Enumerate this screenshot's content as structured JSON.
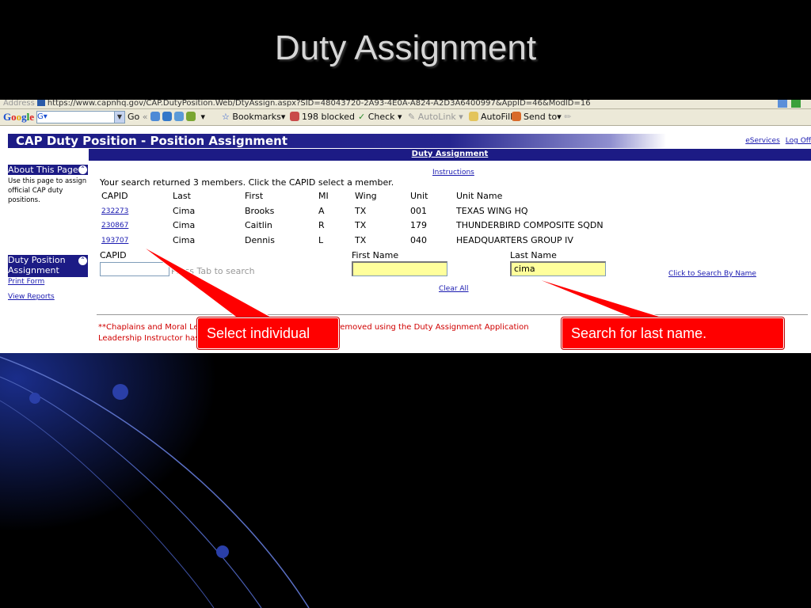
{
  "slide": {
    "title": "Duty Assignment"
  },
  "browser": {
    "address_label": "Address",
    "url": "https://www.capnhq.gov/CAP.DutyPosition.Web/DtyAssign.aspx?SID=48043720-2A93-4E0A-A824-A2D3A6400997&AppID=46&ModID=16",
    "google_logo": [
      "G",
      "o",
      "o",
      "g",
      "l",
      "e"
    ],
    "search_value": "G▾",
    "toolbar": {
      "go": "Go",
      "bookmarks": "Bookmarks▾",
      "blocked": "198 blocked",
      "check": "Check ▾",
      "autolink": "AutoLink ▾",
      "autofill": "AutoFill",
      "send_to": "Send to▾"
    }
  },
  "page": {
    "title": "CAP Duty Position - Position Assignment",
    "top_links": [
      "eServices",
      "Log Off"
    ],
    "section_title": "Duty Assignment",
    "instructions_link": "Instructions",
    "search_result": "Your search returned 3 members. Click the CAPID select a member.",
    "columns": [
      "CAPID",
      "Last",
      "First",
      "MI",
      "Wing",
      "Unit",
      "Unit Name"
    ],
    "rows": [
      {
        "capid": "232273",
        "last": "Cima",
        "first": "Brooks",
        "mi": "A",
        "wing": "TX",
        "unit": "001",
        "unit_name": "TEXAS WING HQ"
      },
      {
        "capid": "230867",
        "last": "Cima",
        "first": "Caitlin",
        "mi": "R",
        "wing": "TX",
        "unit": "179",
        "unit_name": "THUNDERBIRD COMPOSITE SQDN"
      },
      {
        "capid": "193707",
        "last": "Cima",
        "first": "Dennis",
        "mi": "L",
        "wing": "TX",
        "unit": "040",
        "unit_name": "HEADQUARTERS GROUP IV"
      }
    ],
    "form": {
      "capid_label": "CAPID",
      "capid_value": "",
      "tab_hint": "Press Tab to search",
      "first_name_label": "First Name",
      "first_name_value": "",
      "last_name_label": "Last Name",
      "last_name_value": "cima",
      "search_by_name_link": "Click to Search By Name",
      "clear_all_link": "Clear All"
    },
    "notice": {
      "line1": "**Chaplains and Moral Leadership Officers must be entered/removed using the Duty Assignment Application",
      "line2": "Leadership Instructor has"
    },
    "sidebar": {
      "about_header": "About This Page",
      "about_text": "Use this page to assign official CAP duty positions.",
      "duty_header": "Duty Position Assignment",
      "print_form": "Print Form",
      "view_reports": "View Reports"
    }
  },
  "callouts": {
    "select_individual": "Select individual",
    "search_last_name": "Search for last name."
  },
  "colors": {
    "banner": "#1c1b85",
    "callout": "#ff0000",
    "input_highlight": "#ffff9c",
    "link": "#1a1ab0"
  }
}
